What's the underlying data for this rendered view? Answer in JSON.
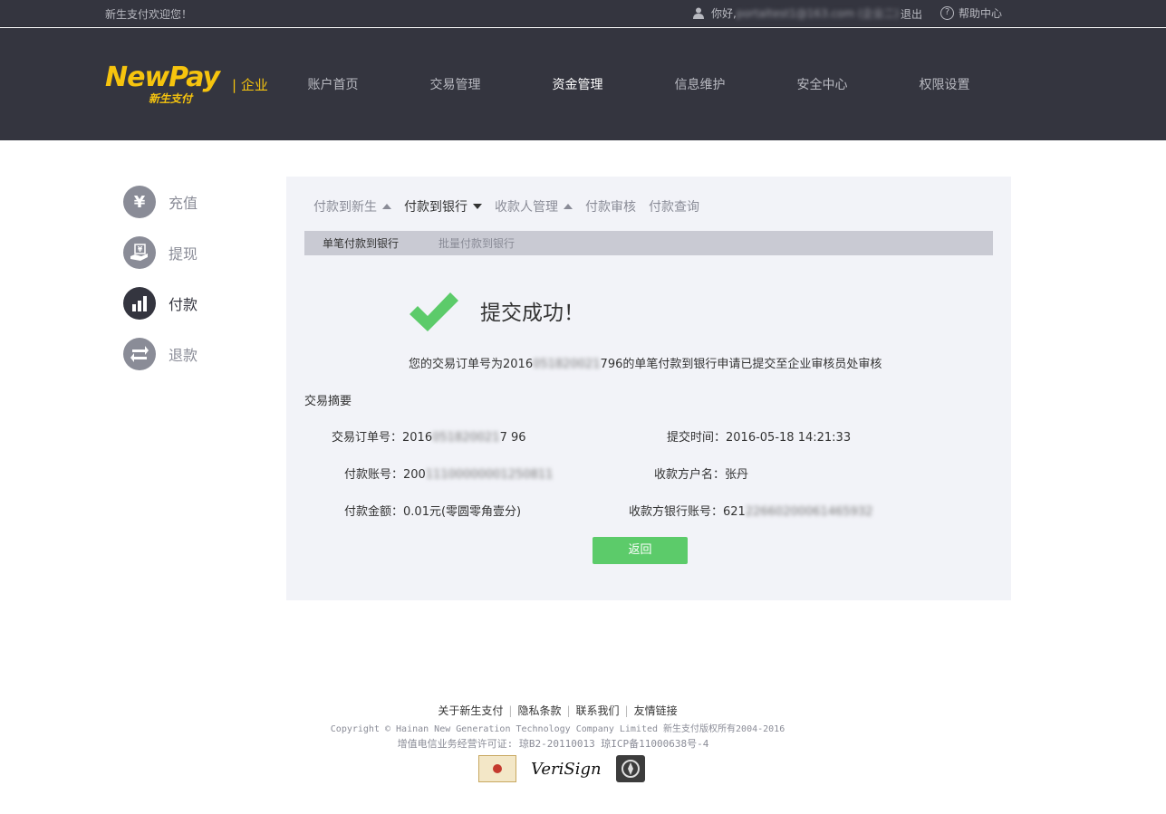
{
  "topbar": {
    "welcome": "新生支付欢迎您！",
    "greeting": "你好,",
    "account_masked": "portaltest1@163.com (企业二)",
    "logout": "退出",
    "help": "帮助中心"
  },
  "header": {
    "logo_text": "NewPay",
    "logo_cn": "新生支付",
    "logo_enterprise": "| 企业",
    "nav": [
      {
        "label": "账户首页",
        "active": false
      },
      {
        "label": "交易管理",
        "active": false
      },
      {
        "label": "资金管理",
        "active": true
      },
      {
        "label": "信息维护",
        "active": false
      },
      {
        "label": "安全中心",
        "active": false
      },
      {
        "label": "权限设置",
        "active": false
      }
    ]
  },
  "sidebar": {
    "items": [
      {
        "label": "充值",
        "icon": "yen-icon",
        "active": false
      },
      {
        "label": "提现",
        "icon": "withdraw-icon",
        "active": false
      },
      {
        "label": "付款",
        "icon": "bar-chart-icon",
        "active": true
      },
      {
        "label": "退款",
        "icon": "refund-arrows-icon",
        "active": false
      }
    ]
  },
  "tabs": [
    {
      "label": "付款到新生",
      "arrow": "up",
      "active": false
    },
    {
      "label": "付款到银行",
      "arrow": "down",
      "active": true
    },
    {
      "label": "收款人管理",
      "arrow": "up",
      "active": false
    },
    {
      "label": "付款审核",
      "arrow": "",
      "active": false
    },
    {
      "label": "付款查询",
      "arrow": "",
      "active": false
    }
  ],
  "subtabs": [
    {
      "label": "单笔付款到银行",
      "active": true
    },
    {
      "label": "批量付款到银行",
      "active": false
    }
  ],
  "result": {
    "title": "提交成功！",
    "notice_prefix": "您的交易订单号为2016",
    "notice_masked": "051820021",
    "notice_suffix": "796的单笔付款到银行申请已提交至企业审核员处审核"
  },
  "summary": {
    "title": "交易摘要",
    "order_label": "交易订单号：",
    "order_prefix": "2016",
    "order_masked": "051820021",
    "order_suffix": "7 96",
    "submit_time_label": "提交时间：",
    "submit_time": "2016-05-18 14:21:33",
    "pay_account_label": "付款账号：",
    "pay_account_prefix": "200",
    "pay_account_masked": "11100000001250811",
    "payee_name_label": "收款方户名：",
    "payee_name": "张丹",
    "amount_label": "付款金额：",
    "amount": "0.01元(零圆零角壹分)",
    "payee_bank_label": "收款方银行账号：",
    "payee_bank_prefix": "621",
    "payee_bank_masked": "22660200061465932"
  },
  "buttons": {
    "back": "返回"
  },
  "footer": {
    "links": [
      "关于新生支付",
      "隐私条款",
      "联系我们",
      "友情链接"
    ],
    "copyright": "Copyright © Hainan New Generation Technology Company Limited 新生支付版权所有2004-2016",
    "license": "增值电信业务经营许可证: 琼B2-20110013 琼ICP备11000638号-4",
    "badge_verisign": "VeriSign"
  },
  "colors": {
    "dark": "#34353f",
    "accent_yellow": "#f6c40e",
    "success_green": "#5ccb6a",
    "panel_bg": "#f2f3f8"
  }
}
